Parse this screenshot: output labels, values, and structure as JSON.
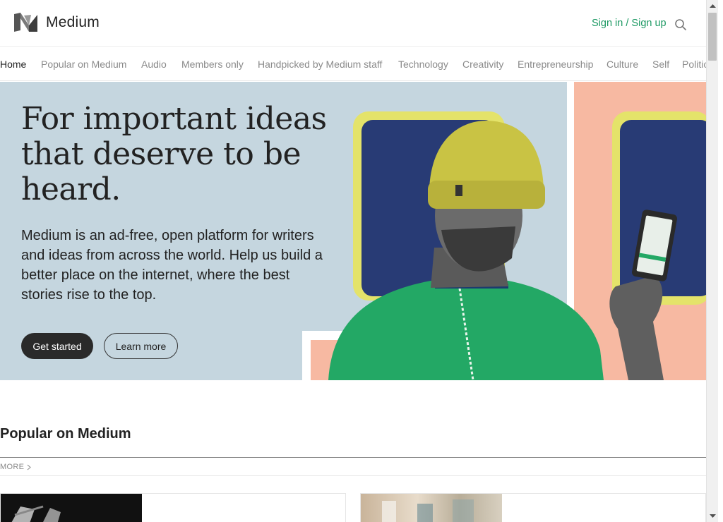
{
  "header": {
    "brand": "Medium",
    "signin_label": "Sign in / Sign up",
    "accent_color": "#1c9963"
  },
  "nav": {
    "items": [
      {
        "label": "Home",
        "active": true
      },
      {
        "label": "Popular on Medium"
      },
      {
        "label": "Audio"
      },
      {
        "label": "Members only"
      },
      {
        "label": "Handpicked by Medium staff"
      },
      {
        "label": "Technology"
      },
      {
        "label": "Creativity"
      },
      {
        "label": "Entrepreneurship"
      },
      {
        "label": "Culture"
      },
      {
        "label": "Self"
      },
      {
        "label": "Politics"
      }
    ]
  },
  "hero": {
    "title": "For important ideas that deserve to be heard.",
    "body": "Medium is an ad-free, open platform for writers and ideas from across the world. Help us build a better place on the internet, where the best stories rise to the top.",
    "primary_button": "Get started",
    "secondary_button": "Learn more",
    "background_color": "#c5d6df"
  },
  "section": {
    "title": "Popular on Medium",
    "more_label": "MORE"
  }
}
